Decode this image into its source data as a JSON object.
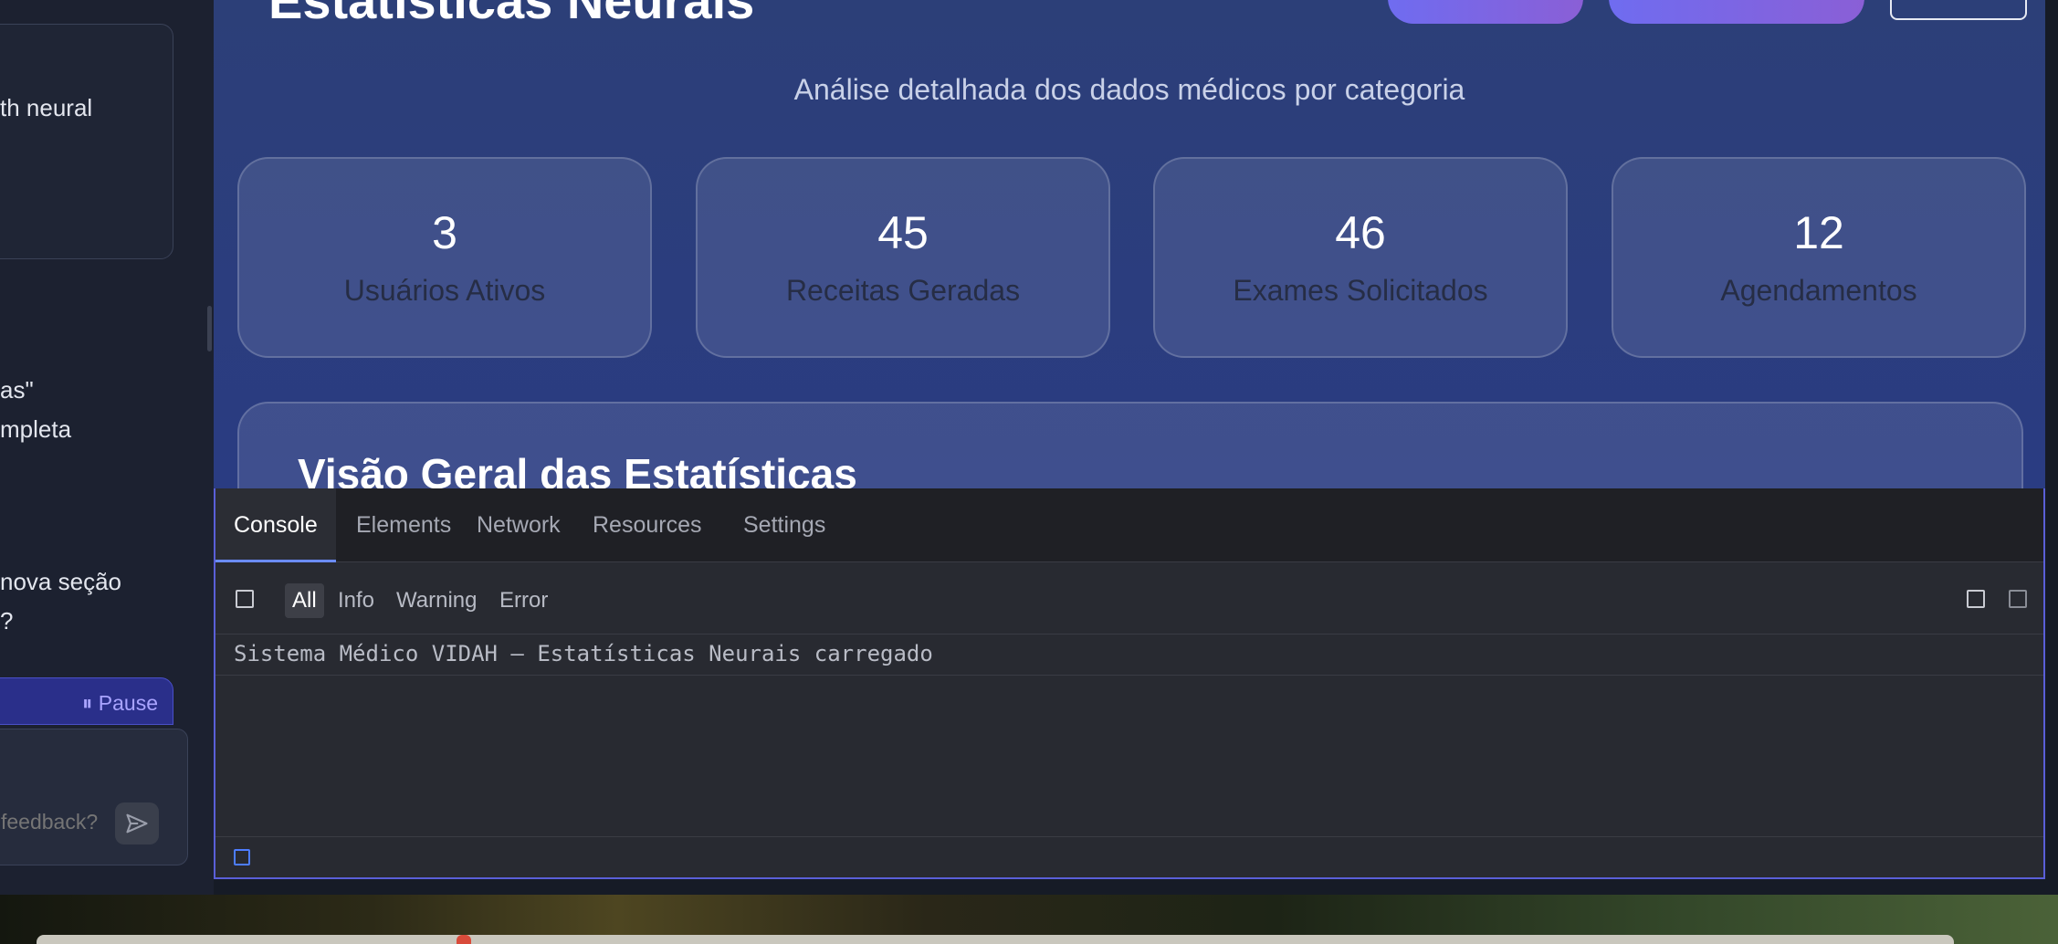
{
  "left_panel": {
    "fragments": [
      "th neural",
      "as\"",
      "mpleta",
      "nova seção",
      "?"
    ],
    "pause_label": "Pause",
    "feedback_placeholder": "feedback?"
  },
  "app": {
    "title": "Estatísticas Neurais",
    "subtitle": "Análise detalhada dos dados médicos por categoria",
    "stats": [
      {
        "value": "3",
        "label": "Usuários Ativos"
      },
      {
        "value": "45",
        "label": "Receitas Geradas"
      },
      {
        "value": "46",
        "label": "Exames Solicitados"
      },
      {
        "value": "12",
        "label": "Agendamentos"
      }
    ],
    "overview_title": "Visão Geral das Estatísticas"
  },
  "devtools": {
    "tabs": [
      "Console",
      "Elements",
      "Network",
      "Resources",
      "Settings"
    ],
    "active_tab": "Console",
    "filters": [
      "All",
      "Info",
      "Warning",
      "Error"
    ],
    "active_filter": "All",
    "log_message": "Sistema Médico VIDAH – Estatísticas Neurais carregado"
  },
  "colors": {
    "accent": "#6b8cff",
    "console_border": "#5a5fd8",
    "app_background": "#2b3d7e"
  }
}
